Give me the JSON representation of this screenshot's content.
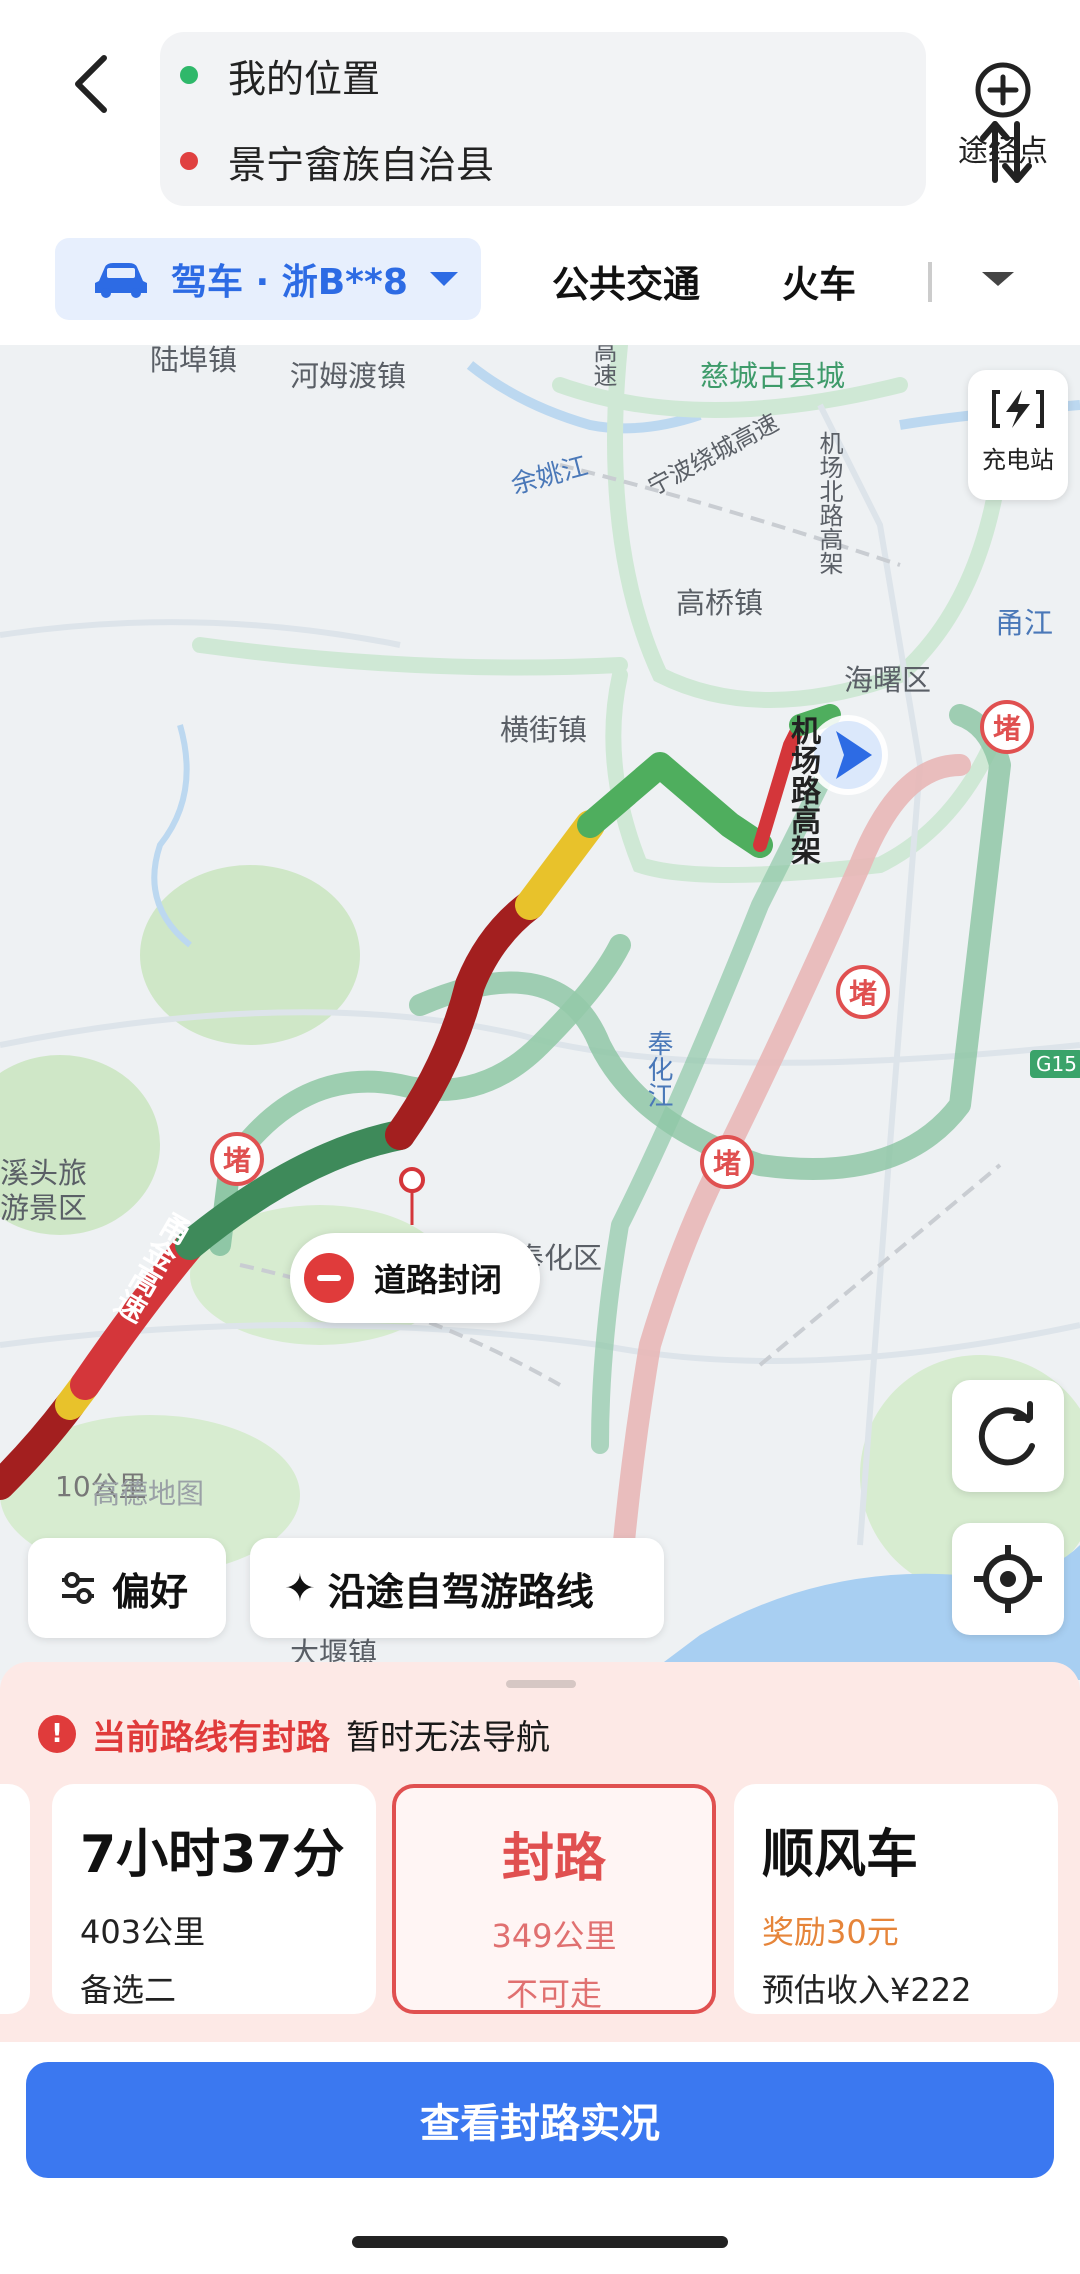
{
  "route": {
    "origin": "我的位置",
    "destination": "景宁畲族自治县",
    "via_label": "途经点"
  },
  "colors": {
    "accent": "#3b78f0",
    "origin_dot": "#2fb86a",
    "destination_dot": "#e04040",
    "jam_red": "#a31f1f",
    "traffic_green": "#3e9a58",
    "traffic_yellow": "#e8c22b",
    "closed_red": "#e03b3b"
  },
  "tabs": {
    "drive": "驾车 · 浙B**8",
    "transit": "公共交通",
    "train": "火车"
  },
  "map": {
    "labels": {
      "lubu": "陆埠镇",
      "hemudu": "河姆渡镇",
      "cicheng": "慈城古县城",
      "yuyao_river": "余姚江",
      "ningbo_ring": "宁波绕城高速",
      "airport_north": "机场北路高架",
      "gaoqiao": "高桥镇",
      "yongjiang": "甬江",
      "haishu": "海曙区",
      "hengjie": "横街镇",
      "airport_elevated": "机场路高架",
      "fenghua_river": "奉化江",
      "fenghua": "奉化区",
      "yongjin": "甬金高速",
      "tourist_a": "溪头旅",
      "tourist_b": "游景区",
      "dayan": "大堰镇",
      "gaosu_top": "高速",
      "g15": "G15",
      "jam_char": "堵"
    },
    "charging_label": "充电站",
    "road_closed": "道路封闭",
    "scale": "10公里",
    "watermark": "高德地图",
    "preference": "偏好",
    "scenic_route": "沿途自驾游路线"
  },
  "alert": {
    "title": "当前路线有封路",
    "message": "暂时无法导航"
  },
  "routes": [
    {
      "big": "7小时37分",
      "line1": "403公里",
      "line2": "备选二"
    },
    {
      "big": "封路",
      "line1": "349公里",
      "line2": "不可走"
    },
    {
      "big": "顺风车",
      "line1": "奖励30元",
      "line2": "预估收入¥222"
    }
  ],
  "cta": "查看封路实况"
}
